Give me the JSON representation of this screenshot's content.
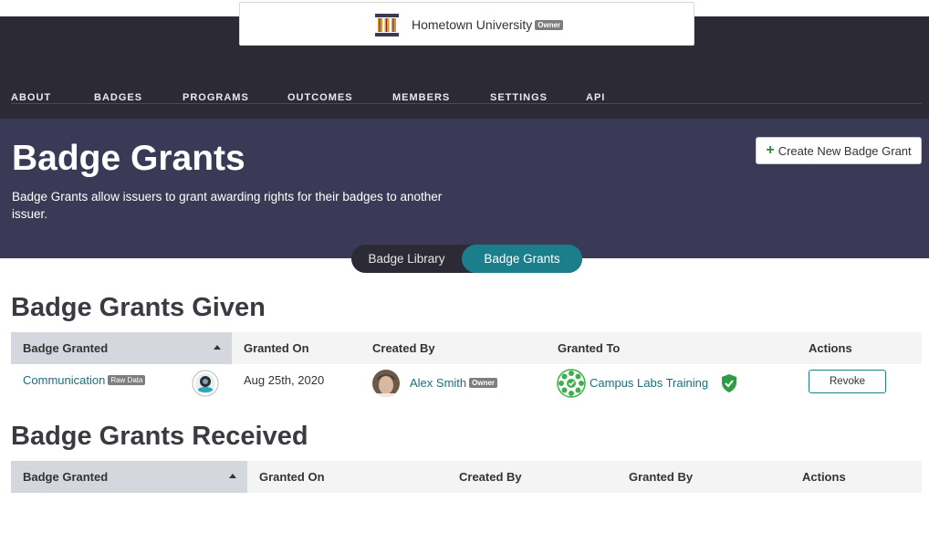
{
  "org": {
    "name": "Hometown University",
    "owner_label": "Owner"
  },
  "nav": {
    "items": [
      "ABOUT",
      "BADGES",
      "PROGRAMS",
      "OUTCOMES",
      "MEMBERS",
      "SETTINGS",
      "API"
    ]
  },
  "hero": {
    "title": "Badge Grants",
    "description": "Badge Grants allow issuers to grant awarding rights for their badges to another issuer.",
    "create_button": "Create New Badge Grant"
  },
  "toggle": {
    "library": "Badge Library",
    "grants": "Badge Grants",
    "active": "Badge Grants"
  },
  "given": {
    "title": "Badge Grants Given",
    "columns": [
      "Badge Granted",
      "Granted On",
      "Created By",
      "Granted To",
      "Actions"
    ],
    "rows": [
      {
        "badge": "Communication",
        "badge_tag": "Raw Data",
        "granted_on": "Aug 25th, 2020",
        "created_by": "Alex Smith",
        "created_by_tag": "Owner",
        "granted_to": "Campus Labs Training",
        "action": "Revoke"
      }
    ]
  },
  "received": {
    "title": "Badge Grants Received",
    "columns": [
      "Badge Granted",
      "Granted On",
      "Created By",
      "Granted By",
      "Actions"
    ]
  },
  "colors": {
    "topbar": "#2c2a35",
    "hero": "#3a3a57",
    "accent": "#1b7f8b",
    "link": "#1b6f7c",
    "verified": "#2e9b45"
  }
}
